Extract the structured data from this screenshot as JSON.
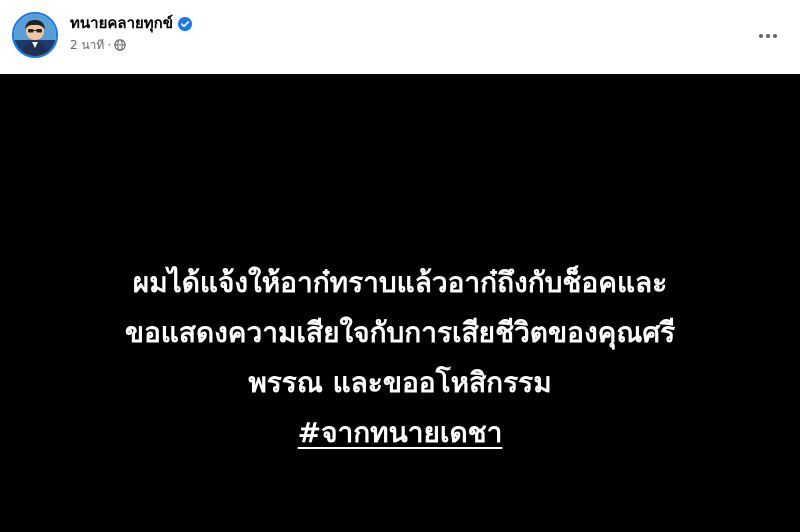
{
  "post": {
    "author": {
      "name": "ทนายคลายทุกข์",
      "verified": true,
      "avatar_icon": "lawyer-portrait-avatar"
    },
    "timestamp": "2 นาที",
    "separator": "·",
    "privacy_icon": "globe-icon",
    "more_icon": "more-options-icon",
    "body": {
      "background": "#000000",
      "text_color": "#ffffff",
      "lines": [
        "ผมได้แจ้งให้อาก๋ทราบแล้วอาก๋ถึงกับช็อคและ",
        "ขอแสดงความเสียใจกับการเสียชีวิตของคุณศรี",
        "พรรณ และขออโหสิกรรม"
      ],
      "hashtag": "#จากทนายเดชา"
    }
  },
  "colors": {
    "verified_badge": "#1877f2",
    "meta_text": "#65676b",
    "name_text": "#050505"
  }
}
